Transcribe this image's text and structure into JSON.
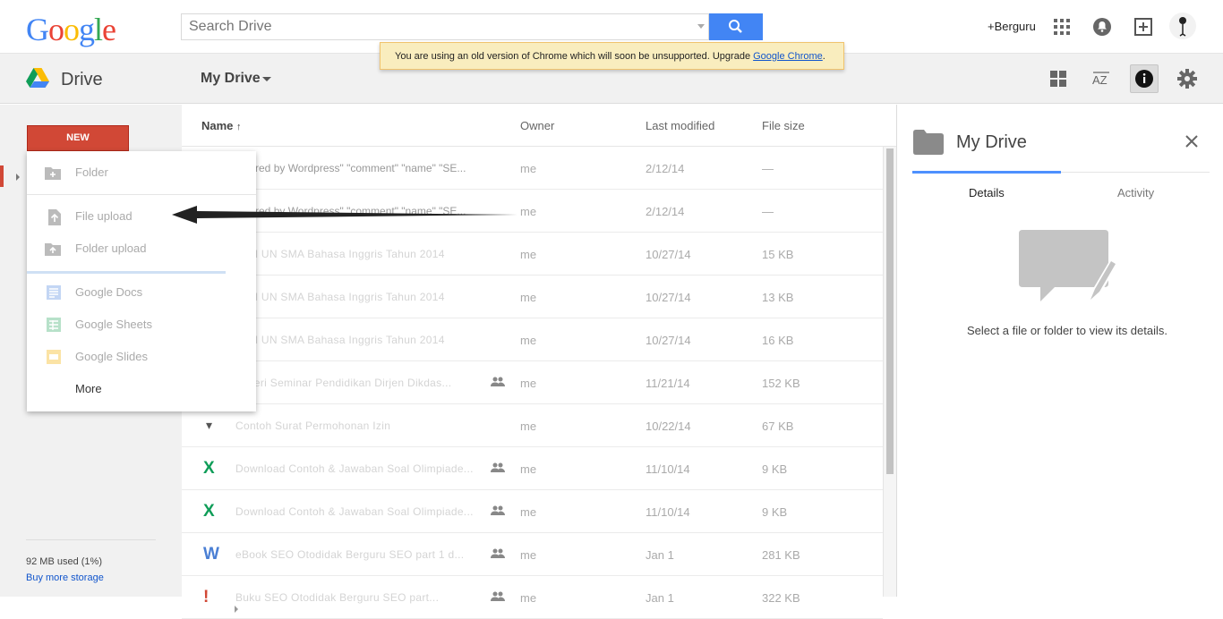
{
  "header": {
    "logo_text": "Google",
    "search_placeholder": "Search Drive",
    "account_name": "+Berguru",
    "icons": [
      "search-icon",
      "apps-grid-icon",
      "notifications-icon",
      "share-add-icon",
      "avatar-icon"
    ]
  },
  "warning": {
    "text": "You are using an old version of Chrome which will soon be unsupported. Upgrade ",
    "link": "Google Chrome",
    "end": "."
  },
  "subbar": {
    "product": "Drive",
    "location": "My Drive",
    "icons": [
      "grid-view-icon",
      "sort-az-icon",
      "info-icon",
      "settings-gear-icon"
    ]
  },
  "sidebar": {
    "new_button": "NEW",
    "storage_used": "92 MB used (1%)",
    "buy_storage": "Buy more storage"
  },
  "new_menu": {
    "items": [
      {
        "label": "Folder",
        "icon": "folder-add-icon"
      },
      {
        "label": "File upload",
        "icon": "file-upload-icon"
      },
      {
        "label": "Folder upload",
        "icon": "folder-upload-icon"
      },
      {
        "label": "Google Docs",
        "icon": "docs-icon"
      },
      {
        "label": "Google Sheets",
        "icon": "sheets-icon"
      },
      {
        "label": "Google Slides",
        "icon": "slides-icon"
      },
      {
        "label": "More",
        "icon": "chevron-right-icon"
      }
    ]
  },
  "table": {
    "columns": {
      "name": "Name",
      "owner": "Owner",
      "modified": "Last modified",
      "size": "File size"
    },
    "rows": [
      {
        "name": "owered by Wordpress\" \"comment\" \"name\" \"SE...",
        "owner": "me",
        "modified": "2/12/14",
        "size": "—",
        "type": "",
        "shared": false
      },
      {
        "name": "owered by Wordpress\" \"comment\" \"name\" \"SE...",
        "owner": "me",
        "modified": "2/12/14",
        "size": "—",
        "type": "",
        "shared": false
      },
      {
        "name": "Soal UN SMA Bahasa Inggris Tahun 2014",
        "owner": "me",
        "modified": "10/27/14",
        "size": "15 KB",
        "type": "",
        "shared": false
      },
      {
        "name": "Soal UN SMA Bahasa Inggris Tahun 2014",
        "owner": "me",
        "modified": "10/27/14",
        "size": "13 KB",
        "type": "",
        "shared": false
      },
      {
        "name": "Soal UN SMA Bahasa Inggris Tahun 2014",
        "owner": "me",
        "modified": "10/27/14",
        "size": "16 KB",
        "type": "",
        "shared": false
      },
      {
        "name": "Materi Seminar Pendidikan Dirjen Dikdas...",
        "owner": "me",
        "modified": "11/21/14",
        "size": "152 KB",
        "type": "",
        "shared": true
      },
      {
        "name": "Contoh Surat Permohonan Izin",
        "owner": "me",
        "modified": "10/22/14",
        "size": "67 KB",
        "type": "▾",
        "shared": false
      },
      {
        "name": "Download Contoh & Jawaban Soal Olimpiade...",
        "owner": "me",
        "modified": "11/10/14",
        "size": "9 KB",
        "type": "X",
        "shared": true
      },
      {
        "name": "Download Contoh & Jawaban Soal Olimpiade...",
        "owner": "me",
        "modified": "11/10/14",
        "size": "9 KB",
        "type": "X",
        "shared": true
      },
      {
        "name": "eBook SEO Otodidak Berguru SEO part 1 d...",
        "owner": "me",
        "modified": "Jan 1",
        "size": "281 KB",
        "type": "W",
        "shared": true
      },
      {
        "name": "Buku SEO Otodidak Berguru SEO part...",
        "owner": "me",
        "modified": "Jan 1",
        "size": "322 KB",
        "type": "!",
        "shared": true
      }
    ]
  },
  "details": {
    "title": "My Drive",
    "tab_details": "Details",
    "tab_activity": "Activity",
    "empty_message": "Select a file or folder to view its details."
  },
  "colors": {
    "accent_blue": "#4285f4",
    "new_red": "#d14836",
    "sheets_green": "#0f9d58",
    "docs_blue": "#4a7fd4"
  }
}
